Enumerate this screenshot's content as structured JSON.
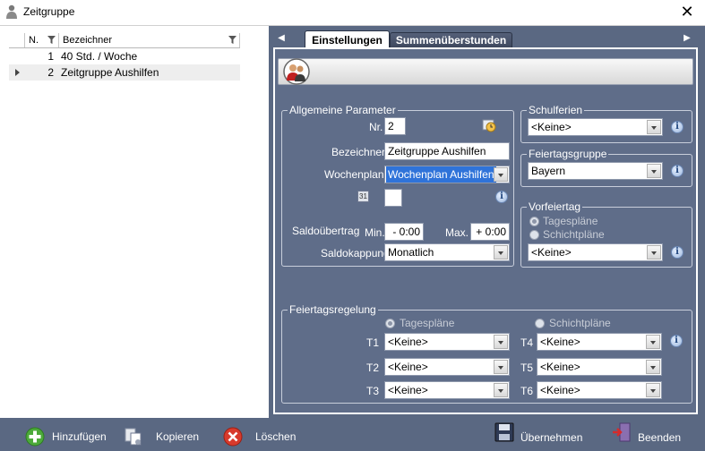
{
  "window": {
    "title": "Zeitgruppe",
    "close": "✕"
  },
  "grid": {
    "columns": [
      "N.",
      "Bezeichner"
    ],
    "rows": [
      {
        "n": "1",
        "name": "40 Std. / Woche"
      },
      {
        "n": "2",
        "name": "Zeitgruppe Aushilfen"
      }
    ]
  },
  "tabs": [
    "Einstellungen",
    "Summenüberstunden"
  ],
  "tab_nav": {
    "left": "◀",
    "right": "▶"
  },
  "allgemeine": {
    "legend": "Allgemeine Parameter",
    "nr_label": "Nr.",
    "nr_value": "2",
    "bezeichner_label": "Bezeichner",
    "bezeichner_value": "Zeitgruppe Aushilfen",
    "wochenplan_label": "Wochenplan",
    "wochenplan_value": "Wochenplan Aushilfen",
    "calendar_label": "31",
    "saldo_label": "Saldoübertrag",
    "min_label": "Min.",
    "min_value": "-  0:00",
    "max_label": "Max.",
    "max_value": "+  0:00",
    "kappung_label": "Saldokappung",
    "kappung_value": "Monatlich"
  },
  "schulferien": {
    "legend": "Schulferien",
    "value": "<Keine>"
  },
  "feiertagsgruppe": {
    "legend": "Feiertagsgruppe",
    "value": "Bayern"
  },
  "vorfeiertag": {
    "legend": "Vorfeiertag",
    "radio1": "Tagespläne",
    "radio2": "Schichtpläne",
    "value": "<Keine>"
  },
  "feiertagsregelung": {
    "legend": "Feiertagsregelung",
    "radio1": "Tagespläne",
    "radio2": "Schichtpläne",
    "rows": [
      {
        "label": "T1",
        "value": "<Keine>"
      },
      {
        "label": "T2",
        "value": "<Keine>"
      },
      {
        "label": "T3",
        "value": "<Keine>"
      },
      {
        "label": "T4",
        "value": "<Keine>"
      },
      {
        "label": "T5",
        "value": "<Keine>"
      },
      {
        "label": "T6",
        "value": "<Keine>"
      }
    ]
  },
  "info_glyph": "i",
  "footer": {
    "add": "Hinzufügen",
    "copy": "Kopieren",
    "delete": "Löschen",
    "apply": "Übernehmen",
    "exit": "Beenden"
  }
}
